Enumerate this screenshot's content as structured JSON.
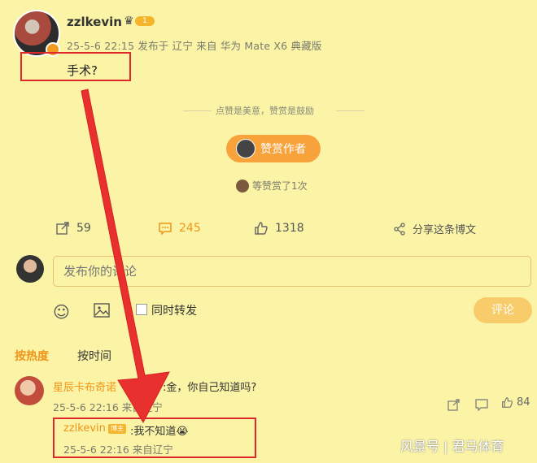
{
  "post": {
    "username": "zzlkevin",
    "crown_icon": "crown-icon",
    "level": "1",
    "meta": "25-5-6 22:15 发布于 辽宁 来自 华为 Mate X6 典藏版",
    "text": "手术?"
  },
  "reward": {
    "hint": "点赞是美意，赞赏是鼓励",
    "button_label": "赞赏作者",
    "count_text": "等赞赏了1次"
  },
  "actions": {
    "repost_count": "59",
    "comment_count": "245",
    "like_count": "1318",
    "share_label": "分享这条博文"
  },
  "composer": {
    "placeholder": "发布你的评论",
    "repost_label": "同时转发",
    "submit_label": "评论"
  },
  "sort": {
    "hot_label": "按热度",
    "time_label": "按时间"
  },
  "comment": {
    "name": "星辰卡布奇诺",
    "text": ":金，你自己知道吗?",
    "meta": "25-5-6 22:16 来自辽宁",
    "like_count": "84"
  },
  "reply": {
    "name": "zzlkevin",
    "badge": "博主",
    "text": ":我不知道😭",
    "meta": "25-5-6 22:16 来自辽宁"
  },
  "watermark": "风景号 | 君马体育",
  "colors": {
    "background": "#fbf4a6",
    "accent": "#f09418",
    "annotation_red": "#e0282c"
  }
}
